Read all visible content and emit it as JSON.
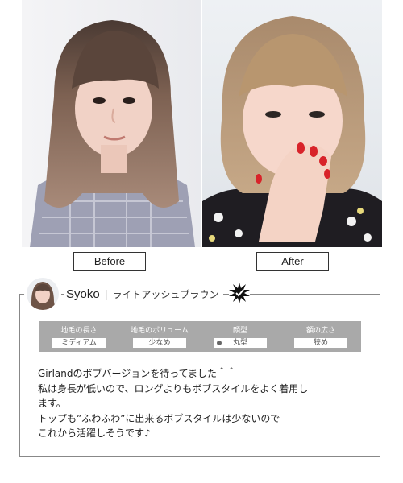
{
  "labels": {
    "before": "Before",
    "after": "After"
  },
  "profile": {
    "name": "Syoko",
    "separator": "|",
    "color_name": "ライトアッシュブラウン"
  },
  "attributes": [
    {
      "label": "地毛の長さ",
      "value": "ミディアム"
    },
    {
      "label": "地毛のボリューム",
      "value": "少なめ"
    },
    {
      "label": "顔型",
      "value": "丸型"
    },
    {
      "label": "額の広さ",
      "value": "狭め"
    }
  ],
  "comment": {
    "lines": [
      "Girlandのボブバージョンを待ってました＾＾",
      "私は身長が低いので、ロングよりもボブスタイルをよく着用し",
      "ます。",
      "トップも”ふわふわ”に出来るボブスタイルは少ないので",
      "これから活躍しそうです♪"
    ]
  },
  "colors": {
    "border": "#888888",
    "attr_bg": "#a9a9a9",
    "nail": "#d8232a"
  },
  "icons": {
    "badge": "starburst-badge-icon"
  }
}
